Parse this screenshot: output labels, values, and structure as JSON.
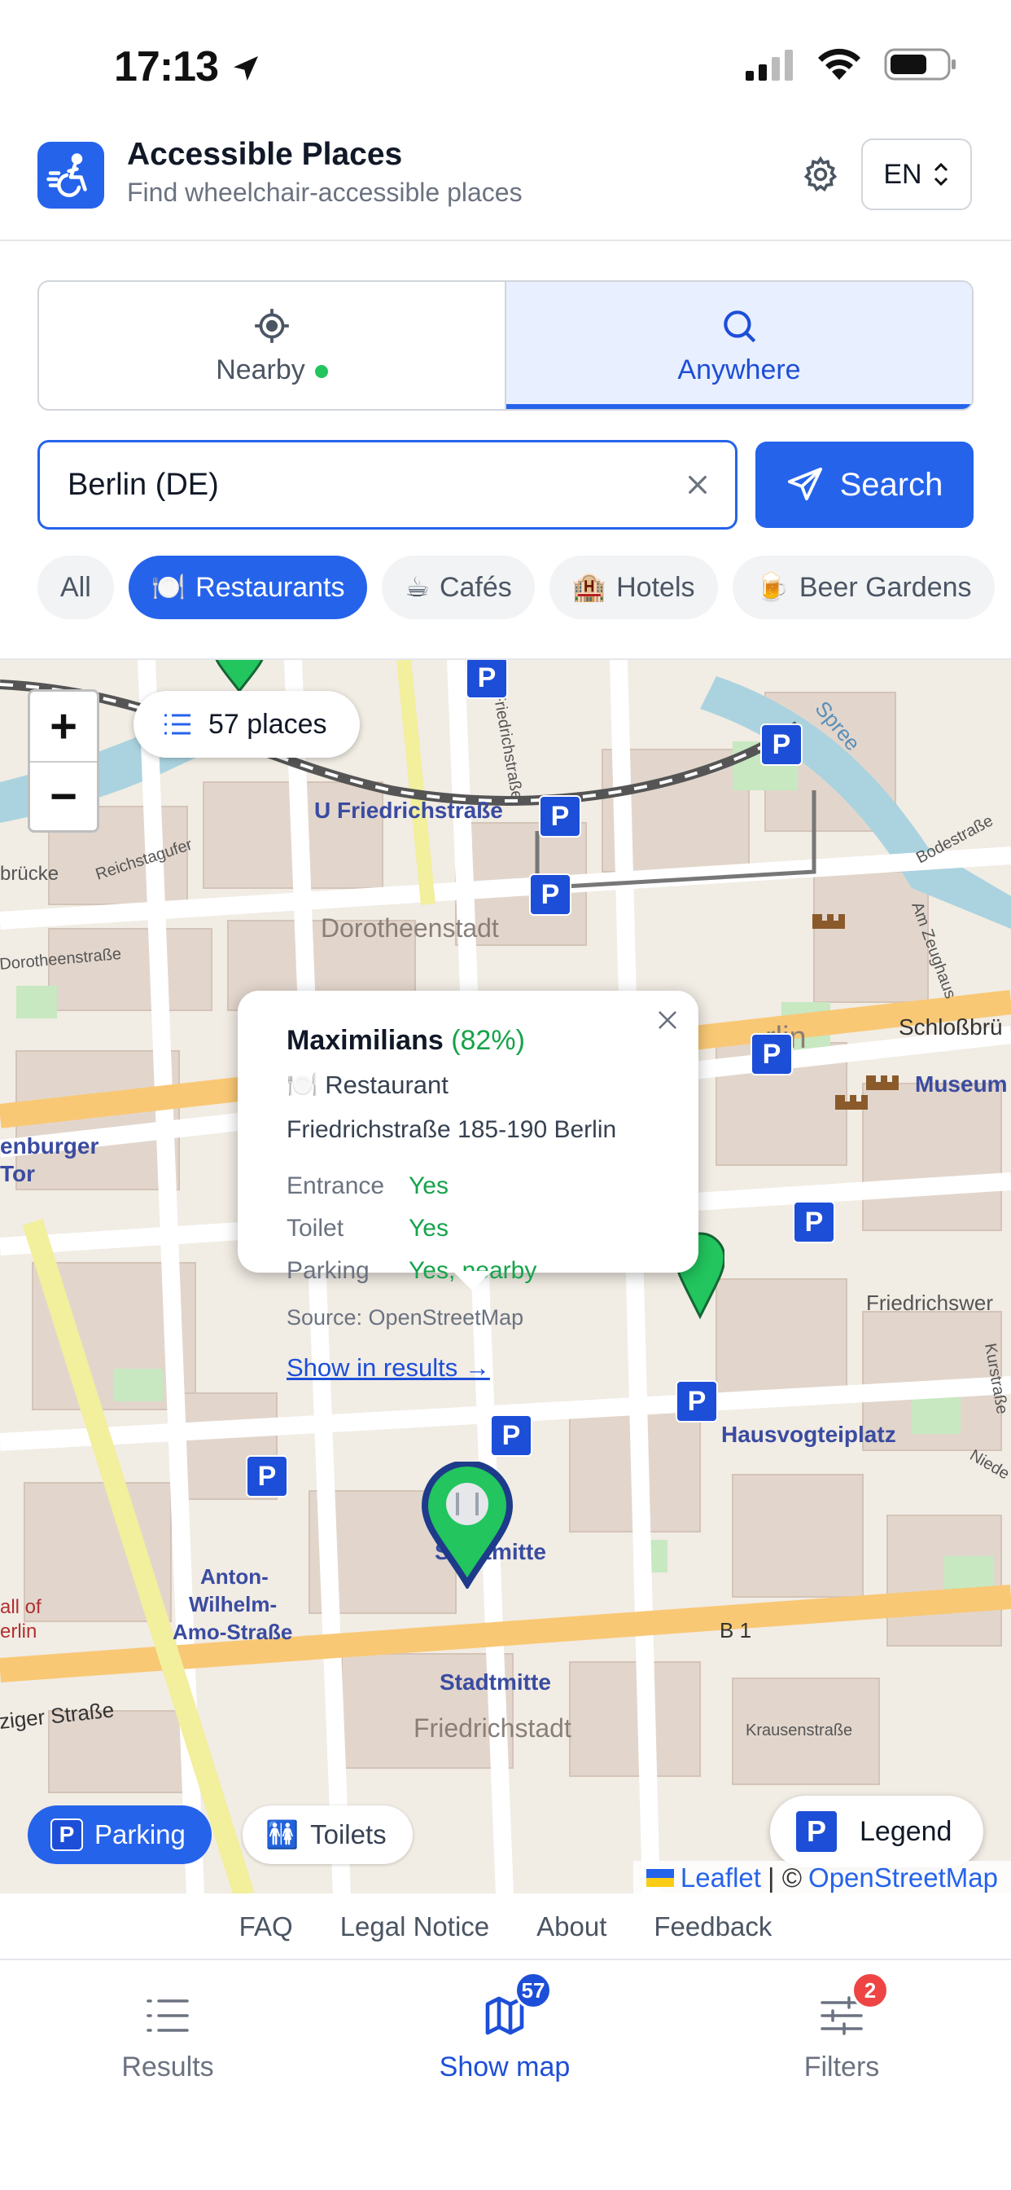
{
  "status": {
    "time": "17:13"
  },
  "header": {
    "title": "Accessible Places",
    "subtitle": "Find wheelchair-accessible places",
    "language": "EN"
  },
  "mode_tabs": [
    {
      "label": "Nearby",
      "active": false
    },
    {
      "label": "Anywhere",
      "active": true
    }
  ],
  "search": {
    "value": "Berlin (DE)",
    "button_label": "Search"
  },
  "categories": [
    {
      "icon": "🍽️",
      "label": "All",
      "active": false
    },
    {
      "icon": "🍽️",
      "label": "Restaurants",
      "active": true
    },
    {
      "icon": "☕",
      "label": "Cafés",
      "active": false
    },
    {
      "icon": "🏨",
      "label": "Hotels",
      "active": false
    },
    {
      "icon": "🍺",
      "label": "Beer Gardens",
      "active": false
    }
  ],
  "map": {
    "places_count": "57 places",
    "zoom_in": "+",
    "zoom_out": "−",
    "labels": {
      "friedrichstrasse_station": "U Friedrichstraße",
      "dorotheenstadt": "Dorotheenstadt",
      "dorotheenstrasse": "Dorotheenstraße",
      "reichstagufer": "Reichstagufer",
      "bruecke": "brücke",
      "brandenburger": "enburger",
      "tor": "Tor",
      "berlin": "rlin",
      "schlossbruecke": "Schloßbrü",
      "museum": "Museum",
      "bodestrasse": "Bodestraße",
      "am_zeughaus": "Am Zeughaus",
      "friedrichswerder": "Friedrichswer",
      "hausvogteiplatz": "Hausvogteiplatz",
      "kurstrasse": "Kurstraße",
      "niederwall": "Niede",
      "stadtmitte_top": "Stadtmitte",
      "stadtmitte": "Stadtmitte",
      "friedrichstadt": "Friedrichstadt",
      "anton_wilhelm_1": "Anton-",
      "anton_wilhelm_2": "Wilhelm-",
      "anton_wilhelm_3": "Amo-Straße",
      "b1": "B 1",
      "krausenstrasse": "Krausenstraße",
      "leipziger": "ziger Straße",
      "mall_1": "all of",
      "mall_2": "erlin",
      "friedrichstrasse_vert": "Friedrichstraße",
      "spree": "Spree"
    },
    "popup": {
      "name": "Maximilians",
      "score": "(82%)",
      "category_icon": "🍽️",
      "category": "Restaurant",
      "address": "Friedrichstraße 185-190 Berlin",
      "rows": [
        {
          "key": "Entrance",
          "value": "Yes"
        },
        {
          "key": "Toilet",
          "value": "Yes"
        },
        {
          "key": "Parking",
          "value": "Yes, nearby"
        }
      ],
      "source": "Source: OpenStreetMap",
      "link": "Show in results →"
    },
    "toggles": {
      "parking_icon": "P",
      "parking": "Parking",
      "toilets_icon": "🚻",
      "toilets": "Toilets"
    },
    "legend_icon": "P",
    "legend": "Legend",
    "attribution": {
      "leaflet": "Leaflet",
      "separator": "| ©",
      "osm": "OpenStreetMap"
    },
    "parking_marker_label": "P",
    "marker_color": "#22c55e",
    "parking_color": "#1d4ed8"
  },
  "footer_links": [
    "FAQ",
    "Legal Notice",
    "About",
    "Feedback"
  ],
  "bottom_nav": [
    {
      "label": "Results",
      "badge": ""
    },
    {
      "label": "Show map",
      "badge": "57"
    },
    {
      "label": "Filters",
      "badge": "2"
    }
  ],
  "colors": {
    "primary": "#2563eb",
    "success": "#16a34a",
    "danger": "#ef4444"
  }
}
